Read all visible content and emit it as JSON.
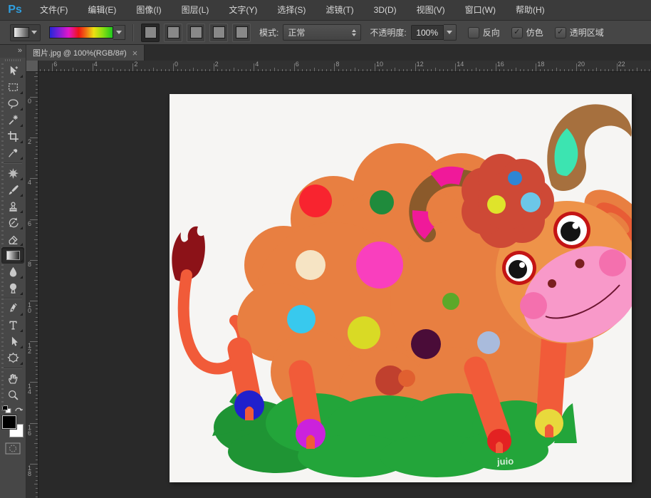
{
  "app": {
    "logo_text": "Ps"
  },
  "menu_bar": {
    "items": [
      "文件(F)",
      "编辑(E)",
      "图像(I)",
      "图层(L)",
      "文字(Y)",
      "选择(S)",
      "滤镜(T)",
      "3D(D)",
      "视图(V)",
      "窗口(W)",
      "帮助(H)"
    ]
  },
  "options_bar": {
    "mode_label": "模式:",
    "mode_value": "正常",
    "opacity_label": "不透明度:",
    "opacity_value": "100%",
    "checkbox_reverse": "反向",
    "checkbox_dither": "仿色",
    "checkbox_transparency": "透明区域",
    "check_glyph": "✓",
    "gradient_types": [
      "linear",
      "radial",
      "angle",
      "reflected",
      "diamond"
    ],
    "selected_gradient_type": "linear"
  },
  "document_tab": {
    "title": "图片.jpg @ 100%(RGB/8#)",
    "close_glyph": "×"
  },
  "toolbar": {
    "collapse_glyph": "»",
    "selected_tool": "gradient-tool",
    "tools": [
      "move",
      "rectangular-marquee",
      "lasso",
      "magic-wand",
      "crop",
      "eyedropper",
      "spot-healing",
      "brush",
      "clone-stamp",
      "history-brush",
      "eraser",
      "gradient",
      "blur",
      "dodge",
      "pen",
      "type",
      "path-selection",
      "custom-shape",
      "hand",
      "zoom"
    ],
    "foreground_color": "#000000",
    "background_color": "#ffffff"
  },
  "rulers": {
    "top": {
      "labels": [
        "6",
        "4",
        "2",
        "0",
        "2",
        "4",
        "6",
        "8",
        "10",
        "12",
        "14",
        "16",
        "18",
        "20",
        "22"
      ],
      "origin": 190,
      "label_spacing": 56.6,
      "tick_step": 5.66,
      "label_offset": 3
    },
    "left": {
      "labels": [
        "0",
        "2",
        "4",
        "6",
        "8",
        "10",
        "12",
        "14",
        "16",
        "18"
      ],
      "origin": 36,
      "label_spacing": 57.2,
      "tick_step": 5.72,
      "label_offset": 0
    }
  },
  "canvas": {
    "watermark": "juio",
    "artwork": {
      "description": "cartoon orange fluffy sheep-cow with polka dots, horns and flower, standing on green grass",
      "colors": {
        "background": "#f6f5f3",
        "body": "#e87f41",
        "legs_tail": "#f15b39",
        "tail_flame": "#8c1218",
        "head": "#ee9349",
        "grass": "#23a53a",
        "flower": "#ce4936",
        "muzzle": "#f899c9",
        "cheek": "#f470ae",
        "horn_brown": "#a6703e",
        "horn_teal": "#3ce4b1",
        "horn_magenta": "#f0199a",
        "eye_ring": "#c41414",
        "hoof_blue": "#2020cc",
        "hoof_magenta": "#cb22dc",
        "hoof_red": "#e32222",
        "hoof_yellow": "#e8d93c"
      }
    }
  }
}
